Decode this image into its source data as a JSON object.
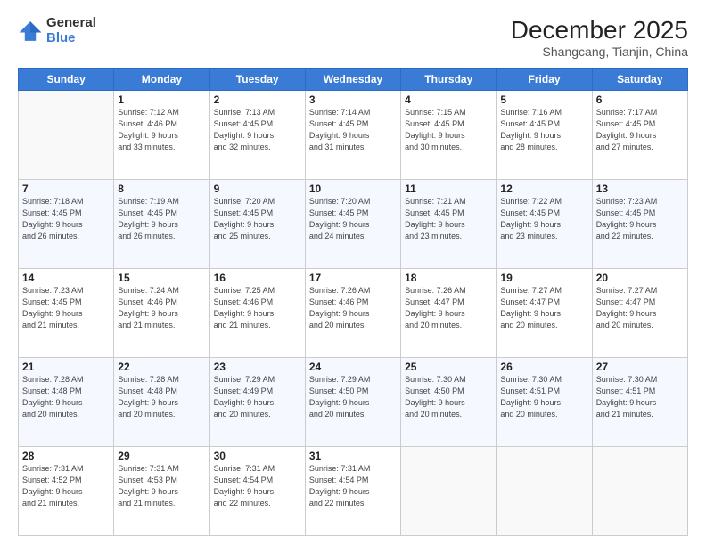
{
  "header": {
    "logo_general": "General",
    "logo_blue": "Blue",
    "month_title": "December 2025",
    "location": "Shangcang, Tianjin, China"
  },
  "weekdays": [
    "Sunday",
    "Monday",
    "Tuesday",
    "Wednesday",
    "Thursday",
    "Friday",
    "Saturday"
  ],
  "weeks": [
    [
      {
        "day": "",
        "info": ""
      },
      {
        "day": "1",
        "info": "Sunrise: 7:12 AM\nSunset: 4:46 PM\nDaylight: 9 hours\nand 33 minutes."
      },
      {
        "day": "2",
        "info": "Sunrise: 7:13 AM\nSunset: 4:45 PM\nDaylight: 9 hours\nand 32 minutes."
      },
      {
        "day": "3",
        "info": "Sunrise: 7:14 AM\nSunset: 4:45 PM\nDaylight: 9 hours\nand 31 minutes."
      },
      {
        "day": "4",
        "info": "Sunrise: 7:15 AM\nSunset: 4:45 PM\nDaylight: 9 hours\nand 30 minutes."
      },
      {
        "day": "5",
        "info": "Sunrise: 7:16 AM\nSunset: 4:45 PM\nDaylight: 9 hours\nand 28 minutes."
      },
      {
        "day": "6",
        "info": "Sunrise: 7:17 AM\nSunset: 4:45 PM\nDaylight: 9 hours\nand 27 minutes."
      }
    ],
    [
      {
        "day": "7",
        "info": "Sunrise: 7:18 AM\nSunset: 4:45 PM\nDaylight: 9 hours\nand 26 minutes."
      },
      {
        "day": "8",
        "info": "Sunrise: 7:19 AM\nSunset: 4:45 PM\nDaylight: 9 hours\nand 26 minutes."
      },
      {
        "day": "9",
        "info": "Sunrise: 7:20 AM\nSunset: 4:45 PM\nDaylight: 9 hours\nand 25 minutes."
      },
      {
        "day": "10",
        "info": "Sunrise: 7:20 AM\nSunset: 4:45 PM\nDaylight: 9 hours\nand 24 minutes."
      },
      {
        "day": "11",
        "info": "Sunrise: 7:21 AM\nSunset: 4:45 PM\nDaylight: 9 hours\nand 23 minutes."
      },
      {
        "day": "12",
        "info": "Sunrise: 7:22 AM\nSunset: 4:45 PM\nDaylight: 9 hours\nand 23 minutes."
      },
      {
        "day": "13",
        "info": "Sunrise: 7:23 AM\nSunset: 4:45 PM\nDaylight: 9 hours\nand 22 minutes."
      }
    ],
    [
      {
        "day": "14",
        "info": "Sunrise: 7:23 AM\nSunset: 4:45 PM\nDaylight: 9 hours\nand 21 minutes."
      },
      {
        "day": "15",
        "info": "Sunrise: 7:24 AM\nSunset: 4:46 PM\nDaylight: 9 hours\nand 21 minutes."
      },
      {
        "day": "16",
        "info": "Sunrise: 7:25 AM\nSunset: 4:46 PM\nDaylight: 9 hours\nand 21 minutes."
      },
      {
        "day": "17",
        "info": "Sunrise: 7:26 AM\nSunset: 4:46 PM\nDaylight: 9 hours\nand 20 minutes."
      },
      {
        "day": "18",
        "info": "Sunrise: 7:26 AM\nSunset: 4:47 PM\nDaylight: 9 hours\nand 20 minutes."
      },
      {
        "day": "19",
        "info": "Sunrise: 7:27 AM\nSunset: 4:47 PM\nDaylight: 9 hours\nand 20 minutes."
      },
      {
        "day": "20",
        "info": "Sunrise: 7:27 AM\nSunset: 4:47 PM\nDaylight: 9 hours\nand 20 minutes."
      }
    ],
    [
      {
        "day": "21",
        "info": "Sunrise: 7:28 AM\nSunset: 4:48 PM\nDaylight: 9 hours\nand 20 minutes."
      },
      {
        "day": "22",
        "info": "Sunrise: 7:28 AM\nSunset: 4:48 PM\nDaylight: 9 hours\nand 20 minutes."
      },
      {
        "day": "23",
        "info": "Sunrise: 7:29 AM\nSunset: 4:49 PM\nDaylight: 9 hours\nand 20 minutes."
      },
      {
        "day": "24",
        "info": "Sunrise: 7:29 AM\nSunset: 4:50 PM\nDaylight: 9 hours\nand 20 minutes."
      },
      {
        "day": "25",
        "info": "Sunrise: 7:30 AM\nSunset: 4:50 PM\nDaylight: 9 hours\nand 20 minutes."
      },
      {
        "day": "26",
        "info": "Sunrise: 7:30 AM\nSunset: 4:51 PM\nDaylight: 9 hours\nand 20 minutes."
      },
      {
        "day": "27",
        "info": "Sunrise: 7:30 AM\nSunset: 4:51 PM\nDaylight: 9 hours\nand 21 minutes."
      }
    ],
    [
      {
        "day": "28",
        "info": "Sunrise: 7:31 AM\nSunset: 4:52 PM\nDaylight: 9 hours\nand 21 minutes."
      },
      {
        "day": "29",
        "info": "Sunrise: 7:31 AM\nSunset: 4:53 PM\nDaylight: 9 hours\nand 21 minutes."
      },
      {
        "day": "30",
        "info": "Sunrise: 7:31 AM\nSunset: 4:54 PM\nDaylight: 9 hours\nand 22 minutes."
      },
      {
        "day": "31",
        "info": "Sunrise: 7:31 AM\nSunset: 4:54 PM\nDaylight: 9 hours\nand 22 minutes."
      },
      {
        "day": "",
        "info": ""
      },
      {
        "day": "",
        "info": ""
      },
      {
        "day": "",
        "info": ""
      }
    ]
  ]
}
